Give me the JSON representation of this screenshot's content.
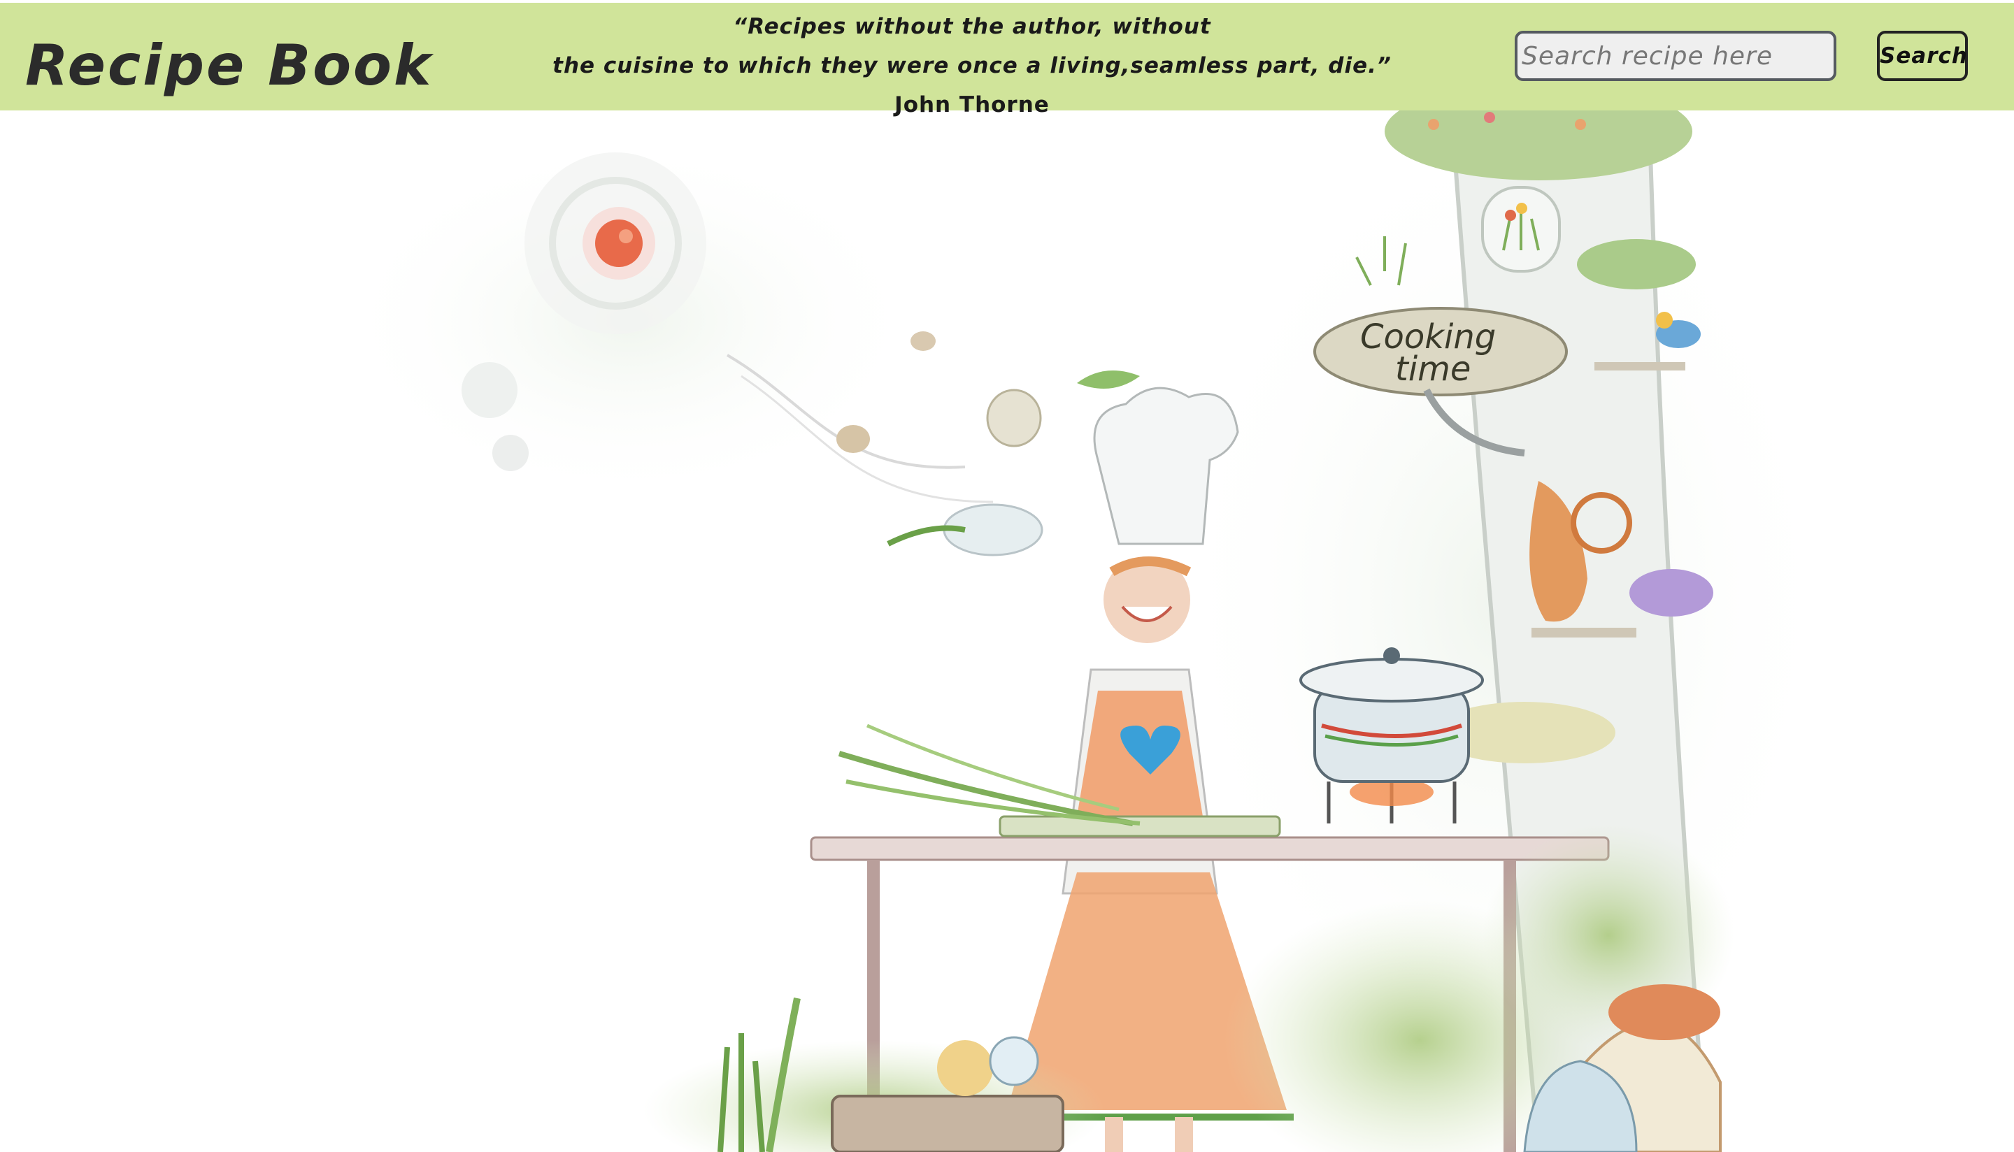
{
  "header": {
    "brand_title": "Recipe Book",
    "quote_lines": [
      "“Recipes without the author, without",
      "the cuisine to which they were once a living,seamless part, die.”"
    ],
    "quote_author": "John Thorne",
    "search_placeholder": "Search recipe here",
    "search_button_label": "Search",
    "background_color": "#d0e49a"
  },
  "hero": {
    "sign_line_1": "Cooking",
    "sign_line_2": "time"
  },
  "icons": [
    "search-button",
    "chef-illustration"
  ]
}
